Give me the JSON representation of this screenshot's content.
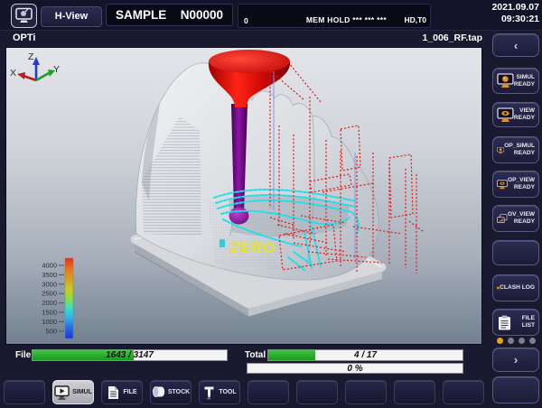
{
  "header": {
    "h_view": "H-View",
    "program_name": "SAMPLE",
    "program_number": "N00000",
    "status_zero": "0",
    "status_mode": "MEM HOLD *** *** ***",
    "status_tool": "HD,T0",
    "date": "2021.09.07",
    "time": "09:30:21"
  },
  "view": {
    "mode": "OPTi",
    "filename": "1_006_RF.tap",
    "zero_label": "ZERO",
    "axis": {
      "x": "X",
      "y": "Y",
      "z": "Z"
    },
    "legend_values": [
      "4000",
      "3500",
      "3000",
      "2500",
      "2000",
      "1500",
      "1000",
      "500"
    ]
  },
  "sidebar": {
    "collapse": "‹",
    "expand": "›",
    "buttons": [
      {
        "line1": "SIMUL",
        "line2": "READY"
      },
      {
        "line1": "VIEW",
        "line2": "READY"
      },
      {
        "line1": "OP_SIMUL",
        "line2": "READY"
      },
      {
        "line1": "OP_VIEW",
        "line2": "READY"
      },
      {
        "line1": "OV_VIEW",
        "line2": "READY"
      },
      {
        "line1": "CLASH LOG",
        "line2": ""
      },
      {
        "line1": "FILE",
        "line2": "LIST"
      }
    ],
    "pager": {
      "total": 4,
      "active": 1
    }
  },
  "progress": {
    "file_label": "File",
    "file_text": "1643 / 3147",
    "file_pct": 52,
    "total_label": "Total",
    "total_text": "4 / 17",
    "total_pct": 24,
    "percent_text": "0 %",
    "percent_pct": 0
  },
  "toolbar": {
    "simul": "SIMUL",
    "file": "FILE",
    "stock": "STOCK",
    "tool": "TOOL"
  },
  "colors": {
    "accent_orange": "#e89018",
    "progress_green": "#2aa82a",
    "tool_red": "#d60d0d",
    "tool_purple": "#8314a0",
    "path_red": "#e41414",
    "path_cyan": "#22dde8",
    "zero_yellow": "#e8e41c"
  }
}
